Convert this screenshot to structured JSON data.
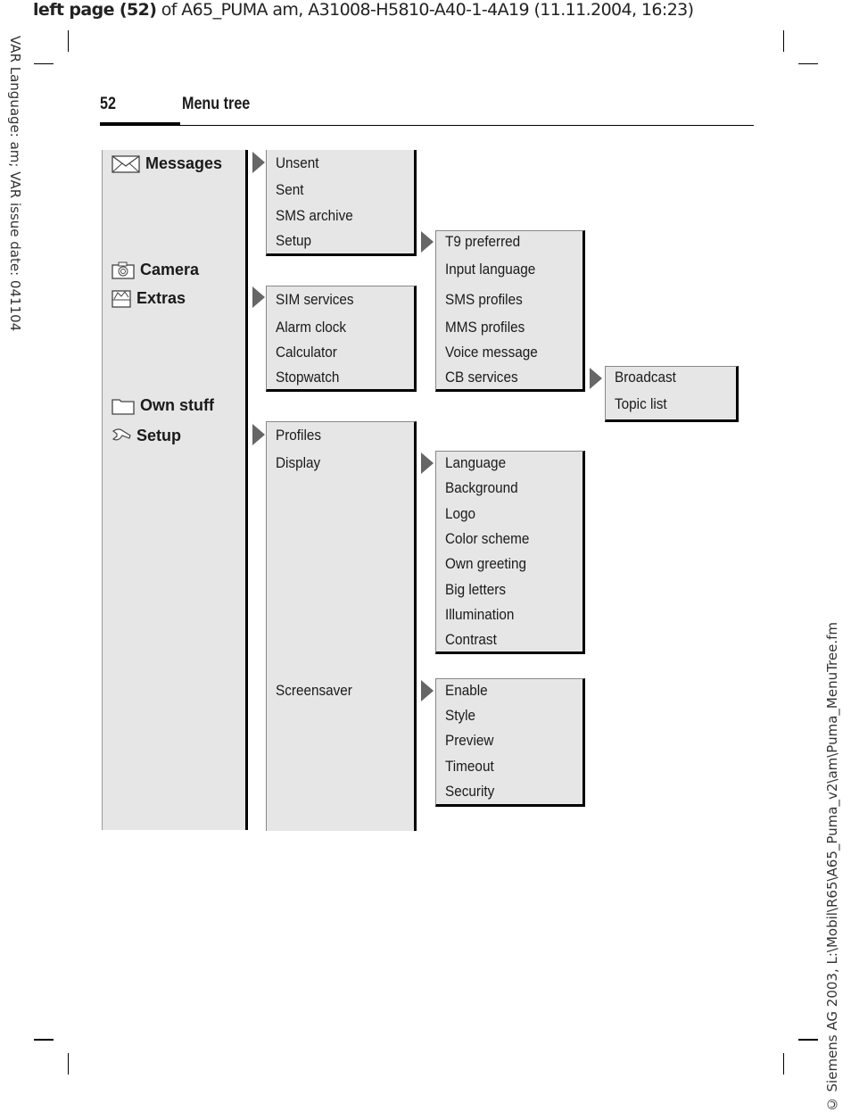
{
  "print_header": {
    "bold_part": "left page (52)",
    "rest": " of A65_PUMA am, A31008-H5810-A40-1-4A19 (11.11.2004, 16:23)"
  },
  "side_left": "VAR Language: am; VAR issue date: 041104",
  "side_right": "© Siemens AG 2003, L:\\Mobil\\R65\\A65_Puma_v2\\am\\Puma_MenuTree.fm",
  "page": {
    "number": "52",
    "title": "Menu tree"
  },
  "main_menu": [
    {
      "label": "Messages",
      "icon": "envelope-icon"
    },
    {
      "label": "Camera",
      "icon": "camera-icon"
    },
    {
      "label": "Extras",
      "icon": "extras-icon"
    },
    {
      "label": "Own stuff",
      "icon": "folder-icon"
    },
    {
      "label": "Setup",
      "icon": "wrench-icon"
    }
  ],
  "messages_submenu": [
    "Unsent",
    "Sent",
    "SMS archive",
    "Setup"
  ],
  "messages_setup_submenu": [
    "T9 preferred",
    "Input language",
    "SMS profiles",
    "MMS profiles",
    "Voice message",
    "CB services"
  ],
  "cb_services_submenu": [
    "Broadcast",
    "Topic list"
  ],
  "extras_submenu": [
    "SIM services",
    "Alarm clock",
    "Calculator",
    "Stopwatch"
  ],
  "setup_submenu": [
    "Profiles",
    "Display",
    "Screensaver"
  ],
  "display_submenu": [
    "Language",
    "Background",
    "Logo",
    "Color scheme",
    "Own greeting",
    "Big letters",
    "Illumination",
    "Contrast"
  ],
  "screensaver_submenu": [
    "Enable",
    "Style",
    "Preview",
    "Timeout",
    "Security"
  ]
}
